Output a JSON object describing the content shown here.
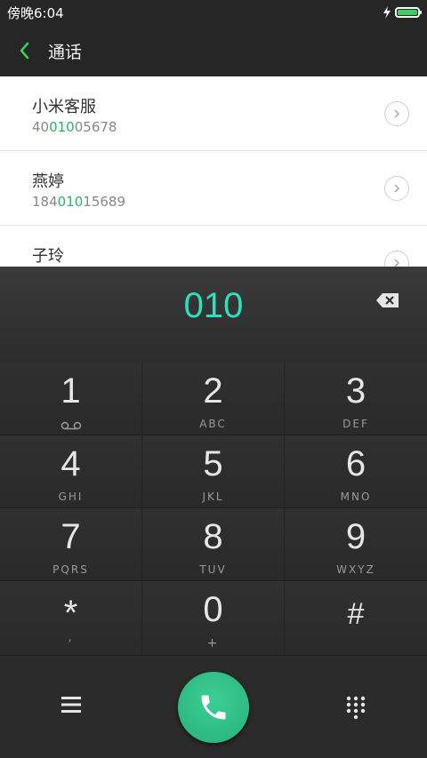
{
  "status": {
    "time": "傍晚6:04",
    "battery_color": "#39d158"
  },
  "header": {
    "title": "通话"
  },
  "results": [
    {
      "name": "小米客服",
      "num_pre": "40",
      "num_match": "010",
      "num_post": "05678"
    },
    {
      "name": "燕婷",
      "num_pre": "184",
      "num_match": "010",
      "num_post": "15689"
    },
    {
      "name": "子玲",
      "num_pre": "",
      "num_match": "",
      "num_post": ""
    }
  ],
  "dialer": {
    "typed": "010"
  },
  "keys": [
    {
      "digit": "1",
      "letters": ""
    },
    {
      "digit": "2",
      "letters": "ABC"
    },
    {
      "digit": "3",
      "letters": "DEF"
    },
    {
      "digit": "4",
      "letters": "GHI"
    },
    {
      "digit": "5",
      "letters": "JKL"
    },
    {
      "digit": "6",
      "letters": "MNO"
    },
    {
      "digit": "7",
      "letters": "PQRS"
    },
    {
      "digit": "8",
      "letters": "TUV"
    },
    {
      "digit": "9",
      "letters": "WXYZ"
    },
    {
      "digit": "*",
      "letters": ","
    },
    {
      "digit": "0",
      "letters": "+"
    },
    {
      "digit": "#",
      "letters": ""
    }
  ],
  "colors": {
    "accent": "#2de0bd",
    "match": "#28b666",
    "call": "#2fbf85"
  },
  "icons": [
    "back-icon",
    "chevron-right-icon",
    "backspace-icon",
    "voicemail-icon",
    "menu-icon",
    "phone-icon",
    "keypad-icon",
    "charging-icon",
    "battery-icon"
  ]
}
